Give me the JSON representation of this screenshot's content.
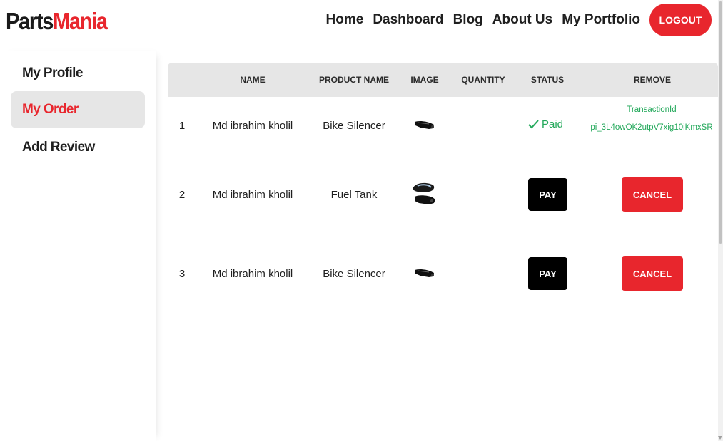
{
  "brand": {
    "part1": "Parts",
    "part2": "Mania"
  },
  "nav": {
    "items": [
      "Home",
      "Dashboard",
      "Blog",
      "About Us",
      "My Portfolio"
    ],
    "logout": "LOGOUT"
  },
  "sidebar": {
    "items": [
      {
        "label": "My Profile"
      },
      {
        "label": "My Order"
      },
      {
        "label": "Add Review"
      }
    ]
  },
  "table": {
    "headers": [
      "NAME",
      "PRODUCT NAME",
      "IMAGE",
      "QUANTITY",
      "STATUS",
      "REMOVE"
    ],
    "rows": [
      {
        "index": "1",
        "name": "Md ibrahim kholil",
        "product": "Bike Silencer",
        "image": "bike-silencer-thumbnail",
        "quantity": "",
        "status": "Paid",
        "transaction_label": "TransactionId",
        "transaction_id": "pi_3L4owOK2utpV7xig10iKmxSR"
      },
      {
        "index": "2",
        "name": "Md ibrahim kholil",
        "product": "Fuel Tank",
        "image": "fuel-tank-thumbnail",
        "quantity": "",
        "pay_label": "PAY",
        "cancel_label": "CANCEL"
      },
      {
        "index": "3",
        "name": "Md ibrahim kholil",
        "product": "Bike Silencer",
        "image": "bike-silencer-thumbnail",
        "quantity": "",
        "pay_label": "PAY",
        "cancel_label": "CANCEL"
      }
    ]
  },
  "colors": {
    "accent": "#e8262d",
    "paid": "#22a85a",
    "header_bg": "#e6e6e6"
  }
}
